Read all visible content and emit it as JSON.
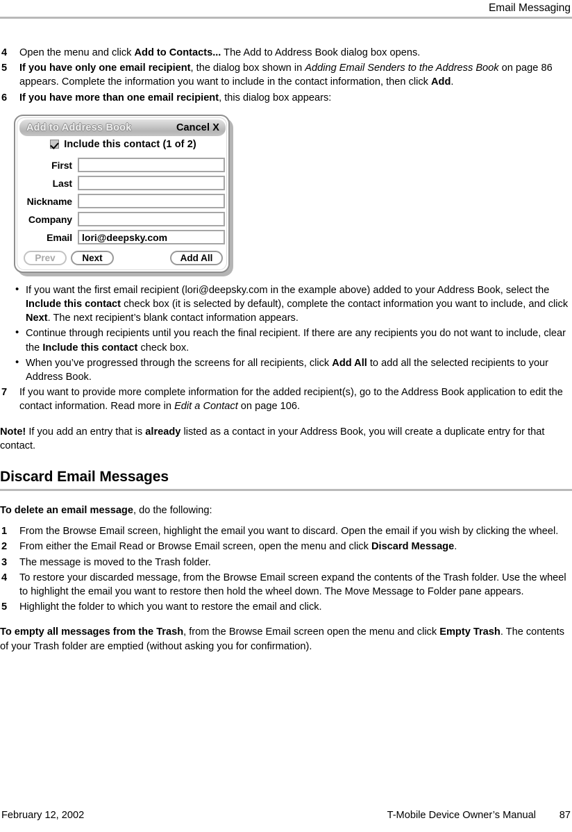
{
  "header": {
    "running_head": "Email Messaging"
  },
  "steps_top": [
    {
      "num": "4",
      "parts": [
        {
          "t": "Open the menu and click ",
          "s": "n"
        },
        {
          "t": "Add to Contacts...",
          "s": "b"
        },
        {
          "t": " The Add to Address Book dialog box opens.",
          "s": "n"
        }
      ]
    },
    {
      "num": "5",
      "parts": [
        {
          "t": "If you have only one email recipient",
          "s": "b"
        },
        {
          "t": ", the dialog box shown in ",
          "s": "n"
        },
        {
          "t": "Adding Email Senders to the Address Book",
          "s": "i"
        },
        {
          "t": " on page 86 appears. Complete the information you want to include in the contact information, then click ",
          "s": "n"
        },
        {
          "t": "Add",
          "s": "b"
        },
        {
          "t": ".",
          "s": "n"
        }
      ]
    },
    {
      "num": "6",
      "parts": [
        {
          "t": "If you have more than one email recipient",
          "s": "b"
        },
        {
          "t": ", this dialog box appears:",
          "s": "n"
        }
      ]
    }
  ],
  "dialog": {
    "title": "Add to Address Book",
    "cancel_label": "Cancel X",
    "checkbox": {
      "checked": true,
      "label": "Include this contact (1 of 2)"
    },
    "fields": [
      {
        "label": "First",
        "value": ""
      },
      {
        "label": "Last",
        "value": ""
      },
      {
        "label": "Nickname",
        "value": ""
      },
      {
        "label": "Company",
        "value": ""
      },
      {
        "label": "Email",
        "value": "lori@deepsky.com"
      }
    ],
    "buttons": [
      {
        "label": "Prev",
        "state": "disabled"
      },
      {
        "label": "Next",
        "state": "enabled"
      },
      {
        "label": "Add All",
        "state": "enabled"
      }
    ]
  },
  "bullets": [
    {
      "parts": [
        {
          "t": "If you want the first email recipient (lori@deepsky.com in the example above) added to your Address Book, select the ",
          "s": "n"
        },
        {
          "t": "Include this contact",
          "s": "b"
        },
        {
          "t": " check box (it is selected by default), complete the contact information you want to include, and click ",
          "s": "n"
        },
        {
          "t": "Next",
          "s": "b"
        },
        {
          "t": ". The next recipient’s blank contact information appears.",
          "s": "n"
        }
      ]
    },
    {
      "parts": [
        {
          "t": "Continue through recipients until you reach the final recipient. If there are any recipients you do not want to include, clear the ",
          "s": "n"
        },
        {
          "t": "Include this contact",
          "s": "b"
        },
        {
          "t": " check box.",
          "s": "n"
        }
      ]
    },
    {
      "parts": [
        {
          "t": "When you’ve progressed through the screens for all recipients, click ",
          "s": "n"
        },
        {
          "t": "Add All",
          "s": "b"
        },
        {
          "t": " to add all the selected recipients to your Address Book.",
          "s": "n"
        }
      ]
    }
  ],
  "step_seven": {
    "num": "7",
    "parts": [
      {
        "t": "If you want to provide more complete information for the added recipient(s), go to the Address Book application to edit the contact information. Read more in ",
        "s": "n"
      },
      {
        "t": "Edit a Contact",
        "s": "i"
      },
      {
        "t": " on page 106.",
        "s": "n"
      }
    ]
  },
  "note": {
    "parts": [
      {
        "t": "Note!",
        "s": "b"
      },
      {
        "t": " If you add an entry that is ",
        "s": "n"
      },
      {
        "t": "already",
        "s": "b"
      },
      {
        "t": " listed as a contact in your Address Book, you will create a duplicate entry for that contact.",
        "s": "n"
      }
    ]
  },
  "section": {
    "title": "Discard Email Messages",
    "intro": {
      "parts": [
        {
          "t": "To delete an email message",
          "s": "b"
        },
        {
          "t": ", do the following:",
          "s": "n"
        }
      ]
    },
    "steps": [
      {
        "num": "1",
        "parts": [
          {
            "t": "From the Browse Email screen, highlight the email you want to discard. Open the email if you wish by clicking the wheel.",
            "s": "n"
          }
        ]
      },
      {
        "num": "2",
        "parts": [
          {
            "t": "From either the Email Read or Browse Email screen, open the menu and click ",
            "s": "n"
          },
          {
            "t": "Discard Message",
            "s": "b"
          },
          {
            "t": ".",
            "s": "n"
          }
        ]
      },
      {
        "num": "3",
        "parts": [
          {
            "t": "The message is moved to the Trash folder.",
            "s": "n"
          }
        ]
      },
      {
        "num": "4",
        "parts": [
          {
            "t": "To restore your discarded message, from the Browse Email screen expand the contents of the Trash folder. Use the wheel to highlight the email you want to restore then hold the wheel down. The Move Message to Folder pane appears.",
            "s": "n"
          }
        ]
      },
      {
        "num": "5",
        "parts": [
          {
            "t": "Highlight the folder to which you want to restore the email and click.",
            "s": "n"
          }
        ]
      }
    ],
    "outro": {
      "parts": [
        {
          "t": "To empty all messages from the Trash",
          "s": "b"
        },
        {
          "t": ", from the Browse Email screen open the menu and click ",
          "s": "n"
        },
        {
          "t": "Empty Trash",
          "s": "b"
        },
        {
          "t": ". The contents of your Trash folder are emptied (without asking you for confirmation).",
          "s": "n"
        }
      ]
    }
  },
  "footer": {
    "date": "February 12, 2002",
    "manual": "T-Mobile Device Owner’s Manual",
    "page_number": "87"
  },
  "colors": {
    "rule": "#b9b9b9",
    "dialog_border": "#8e8e8e",
    "titlebar_gray": "#c2c2c2",
    "disabled_text": "#a8a8a8"
  }
}
